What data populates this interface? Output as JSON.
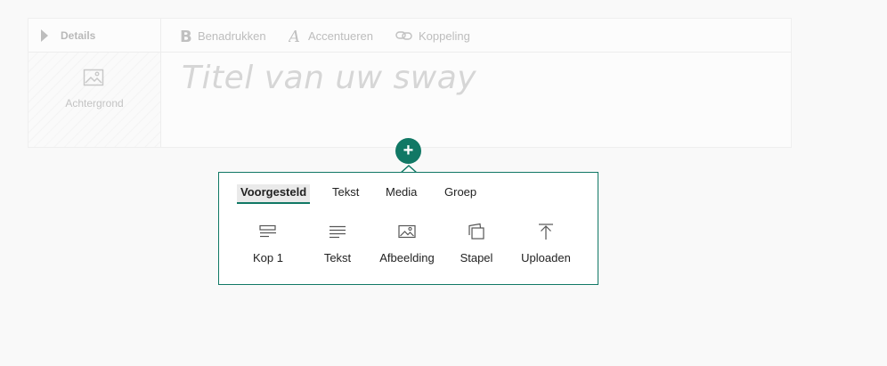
{
  "details": {
    "label": "Details"
  },
  "background_tile": {
    "label": "Achtergrond",
    "icon": "image-icon"
  },
  "toolbar": {
    "bold_label": "Benadrukken",
    "accent_label": "Accentueren",
    "link_label": "Koppeling"
  },
  "title_placeholder": "Titel van uw sway",
  "add_button": {
    "symbol": "+"
  },
  "insert_menu": {
    "tabs": [
      "Voorgesteld",
      "Tekst",
      "Media",
      "Groep"
    ],
    "active_tab": "Voorgesteld",
    "items": [
      {
        "label": "Kop 1",
        "icon": "heading-icon"
      },
      {
        "label": "Tekst",
        "icon": "text-icon"
      },
      {
        "label": "Afbeelding",
        "icon": "image-icon"
      },
      {
        "label": "Stapel",
        "icon": "stack-icon"
      },
      {
        "label": "Uploaden",
        "icon": "upload-icon"
      }
    ]
  },
  "colors": {
    "accent": "#117865"
  }
}
